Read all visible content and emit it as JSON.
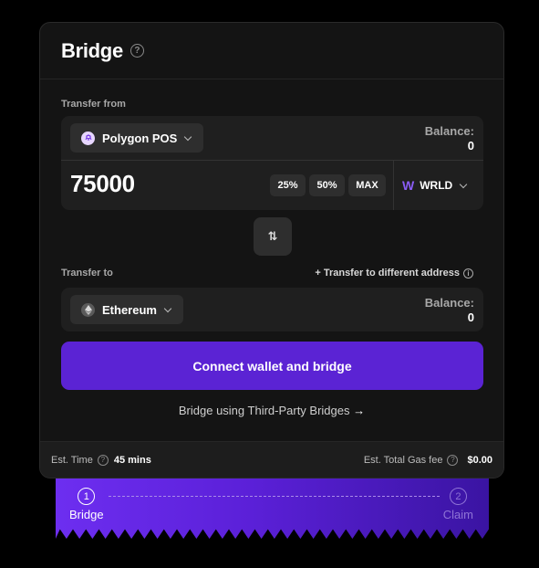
{
  "header": {
    "title": "Bridge"
  },
  "from": {
    "label": "Transfer from",
    "chain": "Polygon POS",
    "balance_label": "Balance:",
    "balance_value": "0",
    "amount": "75000",
    "quick": [
      "25%",
      "50%",
      "MAX"
    ],
    "token": "WRLD",
    "token_logo": "W"
  },
  "to": {
    "label": "Transfer to",
    "different_address": "+ Transfer to different address",
    "chain": "Ethereum",
    "balance_label": "Balance:",
    "balance_value": "0"
  },
  "actions": {
    "connect": "Connect wallet and bridge",
    "third_party": "Bridge using Third-Party Bridges"
  },
  "footer": {
    "time_label": "Est. Time",
    "time_value": "45 mins",
    "gas_label": "Est. Total Gas fee",
    "gas_value": "$0.00"
  },
  "steps": [
    {
      "num": "1",
      "label": "Bridge"
    },
    {
      "num": "2",
      "label": "Claim"
    }
  ],
  "colors": {
    "accent": "#5b23d4",
    "card_bg": "#141414",
    "panel_bg": "#1f1f1f"
  },
  "icons": {
    "help": "question-circle-icon",
    "chevron": "chevron-down-icon",
    "swap": "swap-vertical-icon",
    "arrow": "arrow-right-icon",
    "info": "info-icon"
  }
}
